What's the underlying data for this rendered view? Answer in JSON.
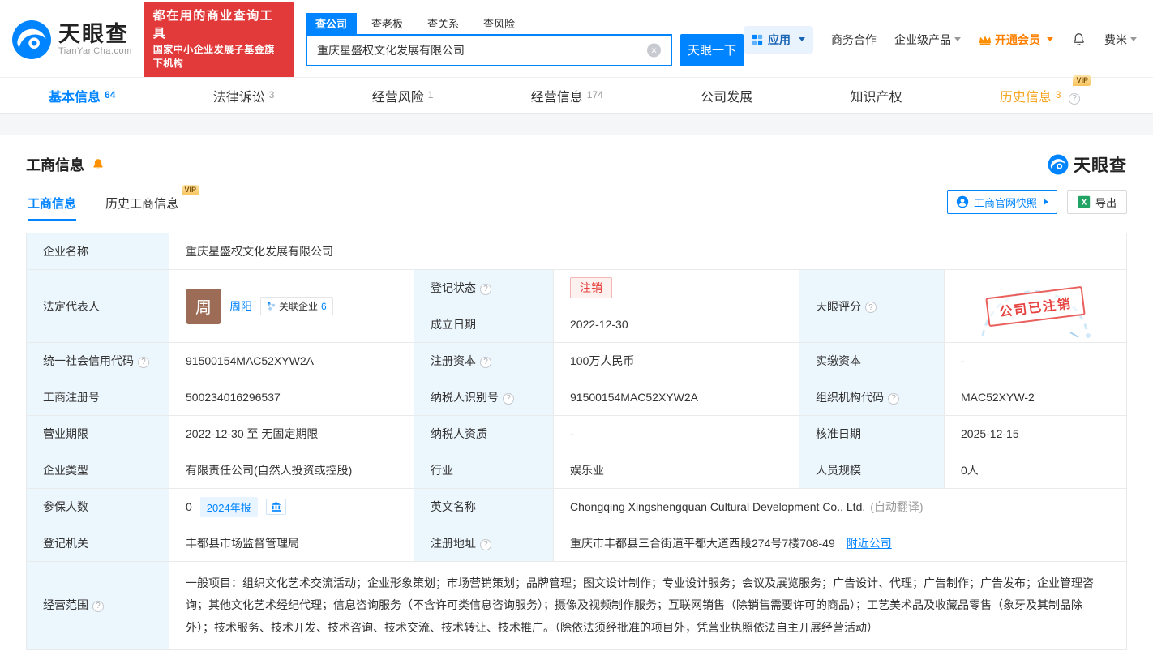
{
  "ui": {
    "vip": "VIP",
    "help": "?"
  },
  "colors": {
    "brand_blue": "#0084ff",
    "banner_red": "#e23a3a",
    "status_red": "#e64340",
    "vip_orange": "#ff8000",
    "label_bg": "#ecf6fd"
  },
  "header": {
    "logo": {
      "brand": "天眼查",
      "domain": "TianYanCha.com"
    },
    "slogan": {
      "line1": "都在用的商业查询工具",
      "line2": "国家中小企业发展子基金旗下机构"
    },
    "search": {
      "tabs": [
        {
          "label": "查公司"
        },
        {
          "label": "查老板"
        },
        {
          "label": "查关系"
        },
        {
          "label": "查风险"
        }
      ],
      "value": "重庆星盛权文化发展有限公司",
      "button": "天眼一下"
    },
    "menu": {
      "apps": "应用",
      "cooperation": "商务合作",
      "enterprise": "企业级产品",
      "vip": "开通会员",
      "user": "费米"
    }
  },
  "nav": {
    "tabs": [
      {
        "label": "基本信息",
        "count": "64"
      },
      {
        "label": "法律诉讼",
        "count": "3"
      },
      {
        "label": "经营风险",
        "count": "1"
      },
      {
        "label": "经营信息",
        "count": "174"
      },
      {
        "label": "公司发展",
        "count": ""
      },
      {
        "label": "知识产权",
        "count": ""
      },
      {
        "label": "历史信息",
        "count": "3"
      }
    ]
  },
  "section": {
    "title": "工商信息",
    "brand": "天眼查",
    "subtabs": [
      {
        "label": "工商信息"
      },
      {
        "label": "历史工商信息"
      }
    ],
    "snapshot_button": "工商官网快照",
    "export_button": "导出"
  },
  "fields": {
    "company_name": {
      "label": "企业名称",
      "value": "重庆星盛权文化发展有限公司"
    },
    "legal_rep": {
      "label": "法定代表人",
      "name": "周阳",
      "avatar": "周",
      "related_label": "关联企业",
      "related_count": "6"
    },
    "reg_status": {
      "label": "登记状态",
      "value": "注销"
    },
    "establish_date": {
      "label": "成立日期",
      "value": "2022-12-30"
    },
    "tyc_score": {
      "label": "天眼评分",
      "stamp": "公司已注销"
    },
    "credit_code": {
      "label": "统一社会信用代码",
      "value": "91500154MAC52XYW2A"
    },
    "reg_capital": {
      "label": "注册资本",
      "value": "100万人民币"
    },
    "paid_capital": {
      "label": "实缴资本",
      "value": "-"
    },
    "reg_number": {
      "label": "工商注册号",
      "value": "500234016296537"
    },
    "taxpayer_id": {
      "label": "纳税人识别号",
      "value": "91500154MAC52XYW2A"
    },
    "org_code": {
      "label": "组织机构代码",
      "value": "MAC52XYW-2"
    },
    "business_term": {
      "label": "营业期限",
      "value": "2022-12-30 至 无固定期限"
    },
    "taxpayer_qualification": {
      "label": "纳税人资质",
      "value": "-"
    },
    "approved_date": {
      "label": "核准日期",
      "value": "2025-12-15"
    },
    "company_type": {
      "label": "企业类型",
      "value": "有限责任公司(自然人投资或控股)"
    },
    "industry": {
      "label": "行业",
      "value": "娱乐业"
    },
    "staff_size": {
      "label": "人员规模",
      "value": "0人"
    },
    "insured_count": {
      "label": "参保人数",
      "value": "0",
      "report_badge": "2024年报"
    },
    "english_name": {
      "label": "英文名称",
      "value": "Chongqing Xingshengquan Cultural Development Co., Ltd.",
      "note": "(自动翻译)"
    },
    "reg_authority": {
      "label": "登记机关",
      "value": "丰都县市场监督管理局"
    },
    "reg_address": {
      "label": "注册地址",
      "value": "重庆市丰都县三合街道平都大道西段274号7楼708-49",
      "nearby_link": "附近公司"
    },
    "business_scope": {
      "label": "经营范围",
      "value": "一般项目：组织文化艺术交流活动；企业形象策划；市场营销策划；品牌管理；图文设计制作；专业设计服务；会议及展览服务；广告设计、代理；广告制作；广告发布；企业管理咨询；其他文化艺术经纪代理；信息咨询服务（不含许可类信息咨询服务）；摄像及视频制作服务；互联网销售（除销售需要许可的商品）；工艺美术品及收藏品零售（象牙及其制品除外）；技术服务、技术开发、技术咨询、技术交流、技术转让、技术推广。（除依法须经批准的项目外，凭营业执照依法自主开展经营活动）"
    }
  }
}
